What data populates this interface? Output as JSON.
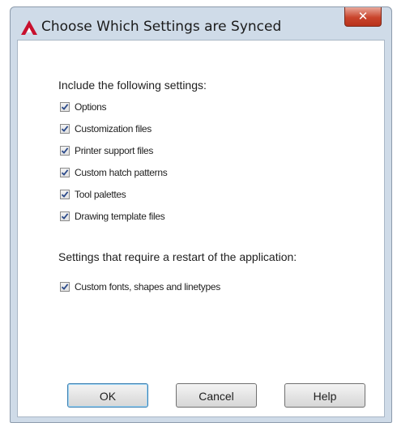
{
  "window": {
    "title": "Choose Which Settings are Synced",
    "close_glyph": "✕",
    "app_icon": "autocad-logo-icon",
    "close_color": "#c9442c"
  },
  "include_section": {
    "heading": "Include the following settings:",
    "items": [
      {
        "label": "Options",
        "checked": true
      },
      {
        "label": "Customization files",
        "checked": true
      },
      {
        "label": "Printer support files",
        "checked": true
      },
      {
        "label": "Custom hatch patterns",
        "checked": true
      },
      {
        "label": "Tool palettes",
        "checked": true
      },
      {
        "label": "Drawing template files",
        "checked": true
      }
    ]
  },
  "restart_section": {
    "heading": "Settings that require a restart of the application:",
    "items": [
      {
        "label": "Custom fonts, shapes and linetypes",
        "checked": true
      }
    ]
  },
  "buttons": {
    "ok": "OK",
    "cancel": "Cancel",
    "help": "Help"
  },
  "colors": {
    "frame": "#cfdbe8",
    "accent": "#c9442c",
    "check_mark": "#2b4a8a"
  }
}
